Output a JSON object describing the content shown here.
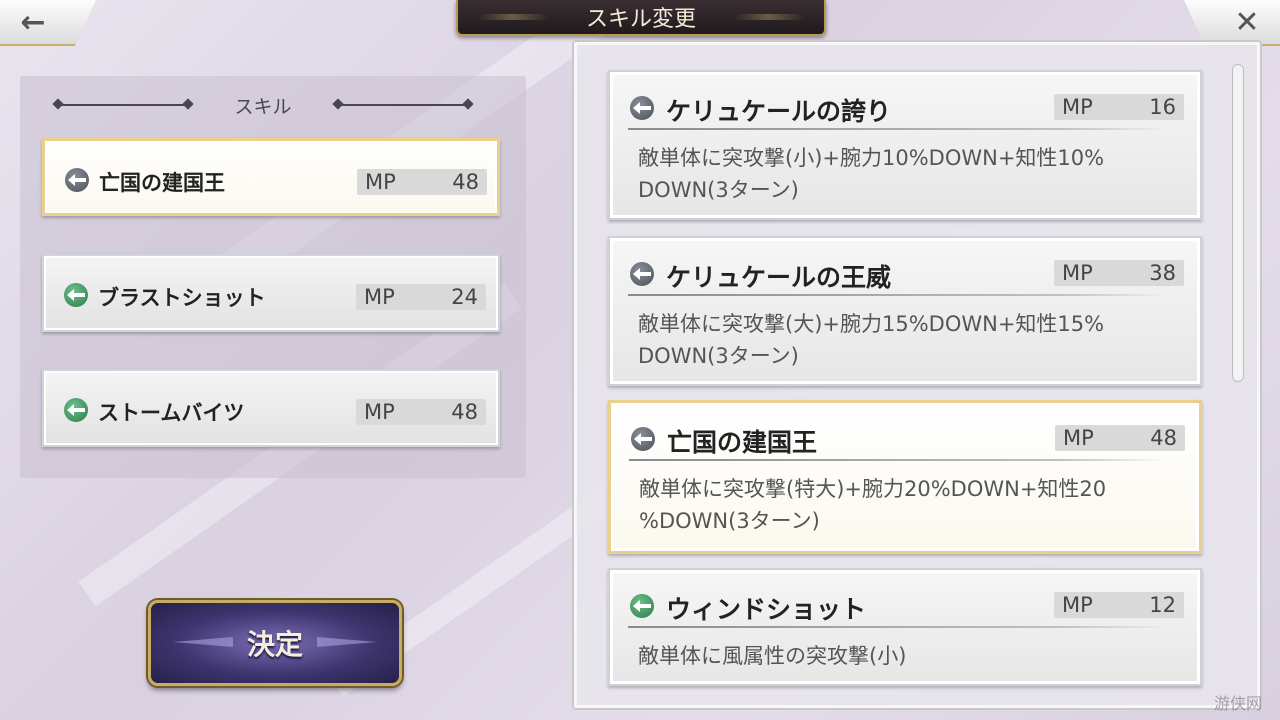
{
  "header": {
    "title": "スキル変更",
    "back_icon": "←",
    "close_icon": "✕"
  },
  "equipped": {
    "section_label": "スキル",
    "slots": [
      {
        "name": "亡国の建国王",
        "mp_label": "MP",
        "mp": "48",
        "icon": "gray",
        "selected": true
      },
      {
        "name": "ブラストショット",
        "mp_label": "MP",
        "mp": "24",
        "icon": "green",
        "selected": false
      },
      {
        "name": "ストームバイツ",
        "mp_label": "MP",
        "mp": "48",
        "icon": "green",
        "selected": false
      }
    ]
  },
  "confirm_button": {
    "label": "決定"
  },
  "skill_list": [
    {
      "name": "ケリュケールの誇り",
      "mp_label": "MP",
      "mp": "16",
      "icon": "gray",
      "selected": false,
      "desc_line1": "敵単体に突攻撃(小)+腕力10%DOWN+知性10%",
      "desc_line2": "DOWN(3ターン)"
    },
    {
      "name": "ケリュケールの王威",
      "mp_label": "MP",
      "mp": "38",
      "icon": "gray",
      "selected": false,
      "desc_line1": "敵単体に突攻撃(大)+腕力15%DOWN+知性15%",
      "desc_line2": "DOWN(3ターン)"
    },
    {
      "name": "亡国の建国王",
      "mp_label": "MP",
      "mp": "48",
      "icon": "gray",
      "selected": true,
      "desc_line1": "敵単体に突攻撃(特大)+腕力20%DOWN+知性20",
      "desc_line2": "%DOWN(3ターン)"
    },
    {
      "name": "ウィンドショット",
      "mp_label": "MP",
      "mp": "12",
      "icon": "green",
      "selected": false,
      "desc_line1": "敵単体に風属性の突攻撃(小)",
      "desc_line2": ""
    }
  ],
  "colors": {
    "selected_border": "#ead08a",
    "title_plate": "#2a2226",
    "confirm_button": "#3f3570",
    "icon_gray": "#5a5f68",
    "icon_green": "#3e9a60"
  },
  "watermark": "游侠网"
}
